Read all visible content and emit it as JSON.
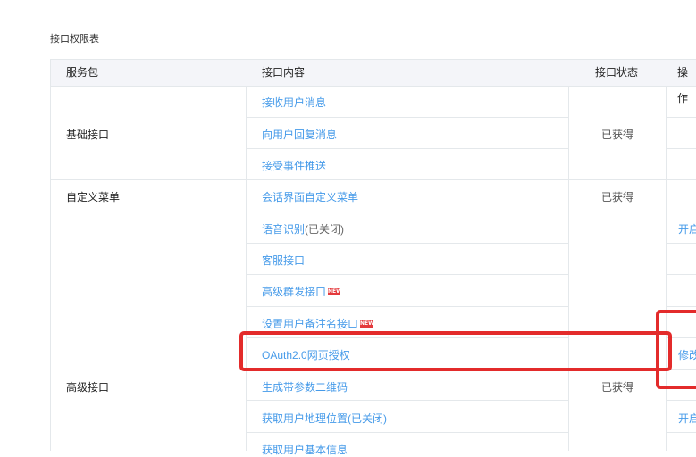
{
  "page": {
    "title": "接口权限表"
  },
  "table": {
    "headers": {
      "package": "服务包",
      "api": "接口内容",
      "status": "接口状态",
      "operation": "操作"
    },
    "groups": [
      {
        "package": "基础接口",
        "status": "已获得"
      },
      {
        "package": "自定义菜单",
        "status": "已获得"
      },
      {
        "package": "高级接口",
        "status": "已获得"
      }
    ],
    "rows": [
      {
        "api": "接收用户消息"
      },
      {
        "api": "向用户回复消息"
      },
      {
        "api": "接受事件推送"
      },
      {
        "api": "会话界面自定义菜单"
      },
      {
        "api": "语音识别",
        "suffix": " (已关闭)",
        "operation": "开启"
      },
      {
        "api": "客服接口"
      },
      {
        "api": "高级群发接口",
        "badge": "NEW"
      },
      {
        "api": "设置用户备注名接口",
        "badge": "NEW"
      },
      {
        "api": "OAuth2.0网页授权",
        "operation": "修改"
      },
      {
        "api": "生成带参数二维码"
      },
      {
        "api": "获取用户地理位置",
        "suffix": "(已关闭)",
        "operation": "开启"
      },
      {
        "api": "获取用户基本信息"
      }
    ]
  },
  "colors": {
    "link": "#459ae9",
    "highlight": "#e32b2b",
    "header_bg": "#f4f5f9",
    "border": "#e4e8eb",
    "badge": "#e4393c"
  }
}
